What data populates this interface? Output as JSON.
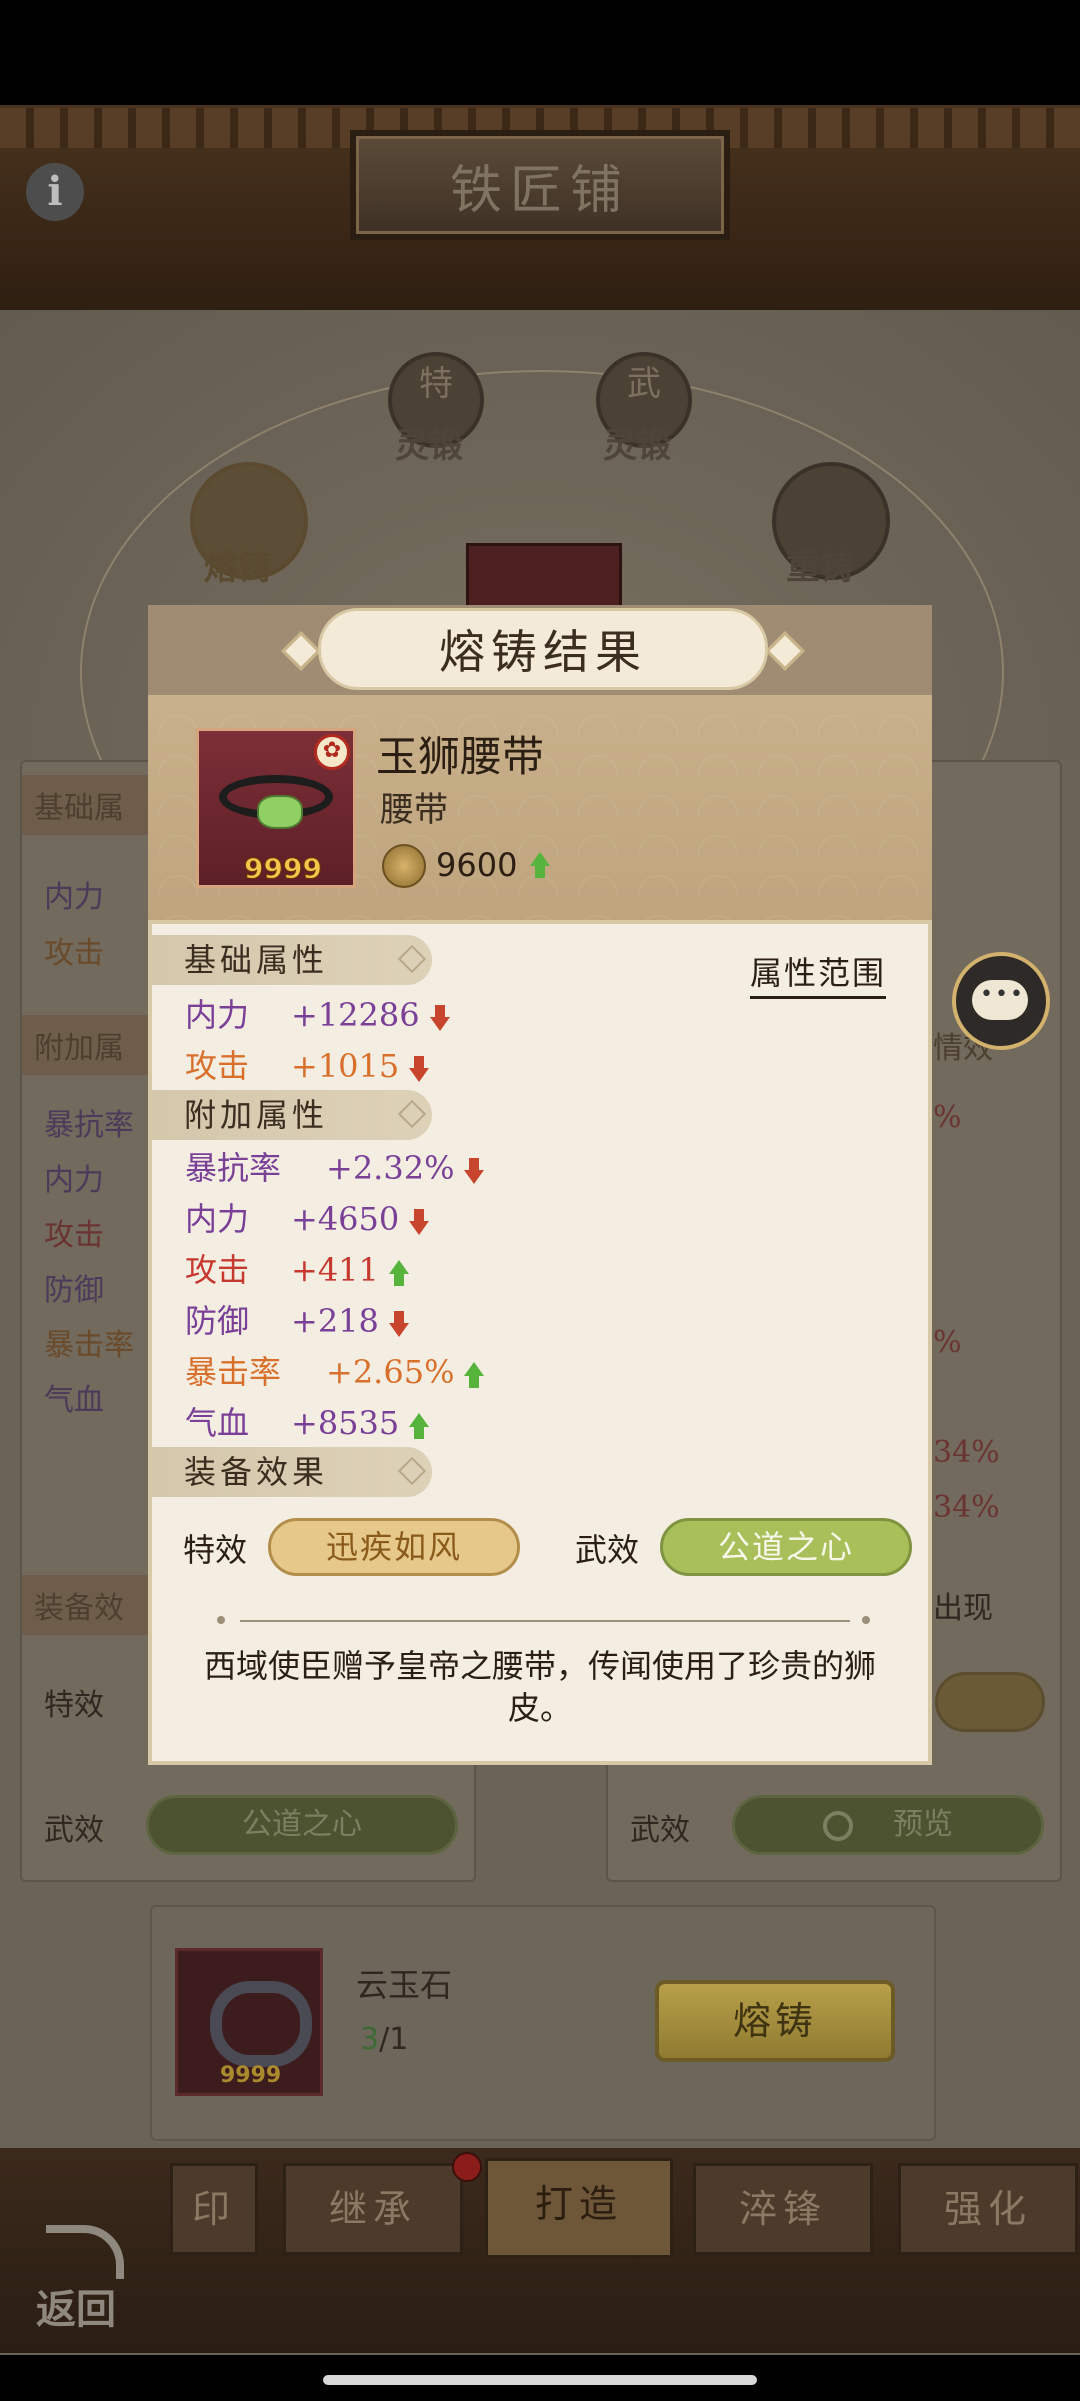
{
  "header": {
    "title": "铁匠铺",
    "info_icon": "i"
  },
  "forge_nav": {
    "top_left": {
      "char": "特",
      "label": "灵锻"
    },
    "top_right": {
      "char": "武",
      "label": "灵锻"
    },
    "left": "熔铸",
    "right": "重铸"
  },
  "bg_left_panel": {
    "base_head": "基础属",
    "base_rows": [
      "内力",
      "攻击"
    ],
    "extra_head": "附加属",
    "extra_rows": [
      "暴抗率",
      "内力",
      "攻击",
      "防御",
      "暴击率",
      "气血"
    ],
    "equip_head": "装备效",
    "special_label": "特效",
    "martial_label": "武效",
    "martial_value": "公道之心"
  },
  "bg_right_panel": {
    "fragment_1": "情效",
    "pct_1": "%",
    "pct_2": "%",
    "pct_3": "34%",
    "pct_4": "34%",
    "appear": "出现",
    "martial_label": "武效",
    "preview": "预览"
  },
  "material": {
    "name": "云玉石",
    "have": "3",
    "need": "/1",
    "count": "9999",
    "smelt_button": "熔铸"
  },
  "bottom_tabs": [
    "印",
    "继承",
    "打造",
    "淬锋",
    "强化"
  ],
  "back_label": "返回",
  "modal": {
    "title": "熔铸结果",
    "item": {
      "name": "玉狮腰带",
      "type": "腰带",
      "count": "9999",
      "power": "9600",
      "power_trend": "up"
    },
    "attr_range_label": "属性范围",
    "base_section": "基础属性",
    "base_attrs": [
      {
        "name": "内力",
        "value": "+12286",
        "trend": "down"
      },
      {
        "name": "攻击",
        "value": "+1015",
        "trend": "down"
      }
    ],
    "extra_section": "附加属性",
    "extra_attrs": [
      {
        "name": "暴抗率",
        "value": "+2.32%",
        "trend": "down"
      },
      {
        "name": "内力",
        "value": "+4650",
        "trend": "down"
      },
      {
        "name": "攻击",
        "value": "+411",
        "trend": "up"
      },
      {
        "name": "防御",
        "value": "+218",
        "trend": "down"
      },
      {
        "name": "暴击率",
        "value": "+2.65%",
        "trend": "up"
      },
      {
        "name": "气血",
        "value": "+8535",
        "trend": "up"
      }
    ],
    "effect_section": "装备效果",
    "special_label": "特效",
    "special_value": "迅疾如风",
    "martial_label": "武效",
    "martial_value": "公道之心",
    "description": "西域使臣赠予皇帝之腰带，传闻使用了珍贵的狮皮。"
  },
  "colors": {
    "purple": "#7a3f97",
    "orange": "#d8702c",
    "red": "#c7382f",
    "up_arrow": "#56b43c",
    "down_arrow": "#c8452d"
  }
}
